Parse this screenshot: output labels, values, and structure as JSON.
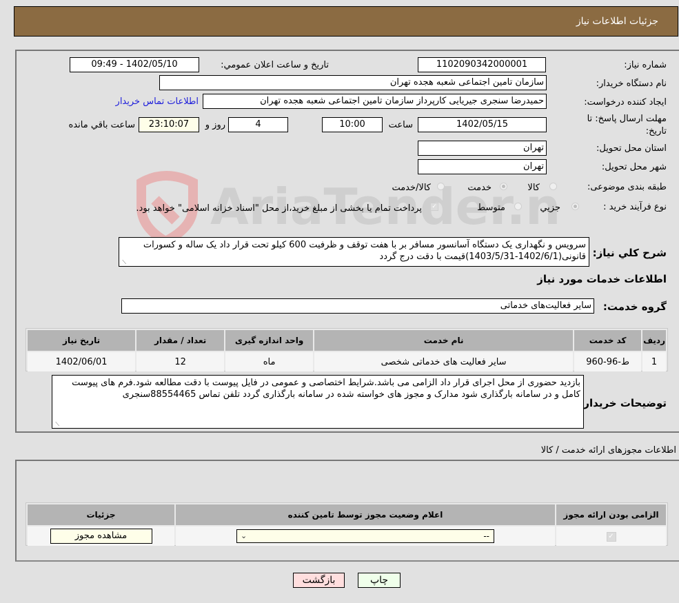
{
  "header": {
    "title": "جزئیات اطلاعات نیاز"
  },
  "fields": {
    "need_number_label": "شماره نیاز:",
    "need_number": "1102090342000001",
    "announce_label": "تاریخ و ساعت اعلان عمومي:",
    "announce_value": "1402/05/10 - 09:49",
    "buyer_org_label": "نام دستگاه خريدار:",
    "buyer_org": "سازمان تامین اجتماعی شعبه هجده تهران",
    "creator_label": "ايجاد كننده درخواست:",
    "creator": "حمیدرضا  سنجری جیریایی کارپرداز سازمان تامین اجتماعی شعبه هجده تهران",
    "contact_link": "اطلاعات تماس خريدار",
    "deadline_label_line1": "مهلت ارسال پاسخ: تا",
    "deadline_label_line2": "تاريخ:",
    "deadline_date": "1402/05/15",
    "time_label": "ساعت",
    "deadline_time": "10:00",
    "days_value": "4",
    "days_label": "روز و",
    "remaining_time": "23:10:07",
    "remaining_label": "ساعت باقي مانده",
    "province_label": "استان محل تحويل:",
    "province": "تهران",
    "city_label": "شهر محل تحويل:",
    "city": "تهران",
    "category_label": "طبقه بندی موضوعی:",
    "category_options": [
      "کالا",
      "خدمت",
      "کالا/خدمت"
    ],
    "category_selected": "خدمت",
    "process_label": "نوع فرآيند خريد :",
    "process_options": [
      "جزيي",
      "متوسط"
    ],
    "process_selected": "جزيي",
    "treasury_note": "پرداخت تمام يا بخشی از مبلغ خريد،از محل \"اسناد خزانه اسلامی\" خواهد بود."
  },
  "description": {
    "label": "شرح كلي نياز:",
    "text": "سرویس و نگهداری یک دستگاه آسانسور مسافر بر با هفت توقف و ظرفیت 600 کیلو تحت قرار داد یک ساله و کسورات قانونی(1402/6/1-1403/5/31)قیمت با دقت درج گردد"
  },
  "services": {
    "section_title": "اطلاعات خدمات مورد نياز",
    "group_label": "گروه خدمت:",
    "group_value": "سایر فعالیت‌های خدماتی",
    "columns": [
      "رديف",
      "کد خدمت",
      "نام خدمت",
      "واحد اندازه گيری",
      "تعداد / مقدار",
      "تاريخ نياز"
    ],
    "rows": [
      [
        "1",
        "ط-96-960",
        "سایر فعالیت های خدماتی شخصی",
        "ماه",
        "12",
        "1402/06/01"
      ]
    ]
  },
  "buyer_notes": {
    "label": "توضيحات خريدار:",
    "text": "بازدید حضوری از محل اجرای قرار داد الزامی می باشد.شرایط اختصاصی و عمومی در فایل پیوست با دقت مطالعه شود.فرم های پیوست کامل و در سامانه بارگذاری شود مدارک و مجوز های خواسته شده در سامانه بارگذاری گردد تلفن تماس 88554465سنجری"
  },
  "permits": {
    "section_title": "اطلاعات مجوزهای ارائه خدمت / کالا",
    "columns": [
      "الزامی بودن ارائه مجوز",
      "اعلام وضعيت مجوز توسط تامين کننده",
      "جزئيات"
    ],
    "row": {
      "required_checked": true,
      "status_selected": "--",
      "view_button": "مشاهده مجوز"
    }
  },
  "buttons": {
    "print": "چاپ",
    "back": "بازگشت"
  },
  "watermark": {
    "text": "AriaTender.neT"
  },
  "colors": {
    "header_bg": "#8b6b42",
    "link": "#1d1ddb",
    "back_btn": "#ffdede",
    "print_btn": "#efffea"
  }
}
